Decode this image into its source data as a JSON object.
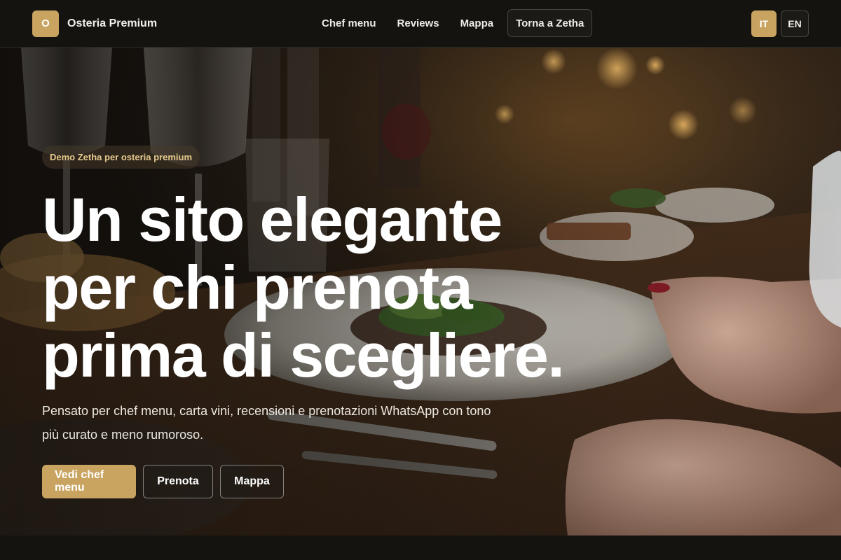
{
  "brand": {
    "initial": "O",
    "name": "Osteria Premium"
  },
  "nav": {
    "links": [
      "Chef menu",
      "Reviews",
      "Mappa"
    ],
    "back_label": "Torna a Zetha"
  },
  "lang": {
    "active": "IT",
    "other": "EN"
  },
  "hero": {
    "badge": "Demo Zetha per osteria premium",
    "title_lines": [
      "Un sito elegante",
      "per chi prenota",
      "prima di scegliere."
    ],
    "subtitle": "Pensato per chef menu, carta vini, recensioni e prenotazioni WhatsApp con tono più curato e meno rumoroso.",
    "primary_cta": "Vedi chef menu",
    "secondary_cta": "Prenota",
    "tertiary_cta": "Mappa",
    "photo_icon": "restaurant-table-photo"
  },
  "colors": {
    "accent": "#c9a461",
    "background": "#13120f",
    "badge_text": "#e6c98e"
  }
}
